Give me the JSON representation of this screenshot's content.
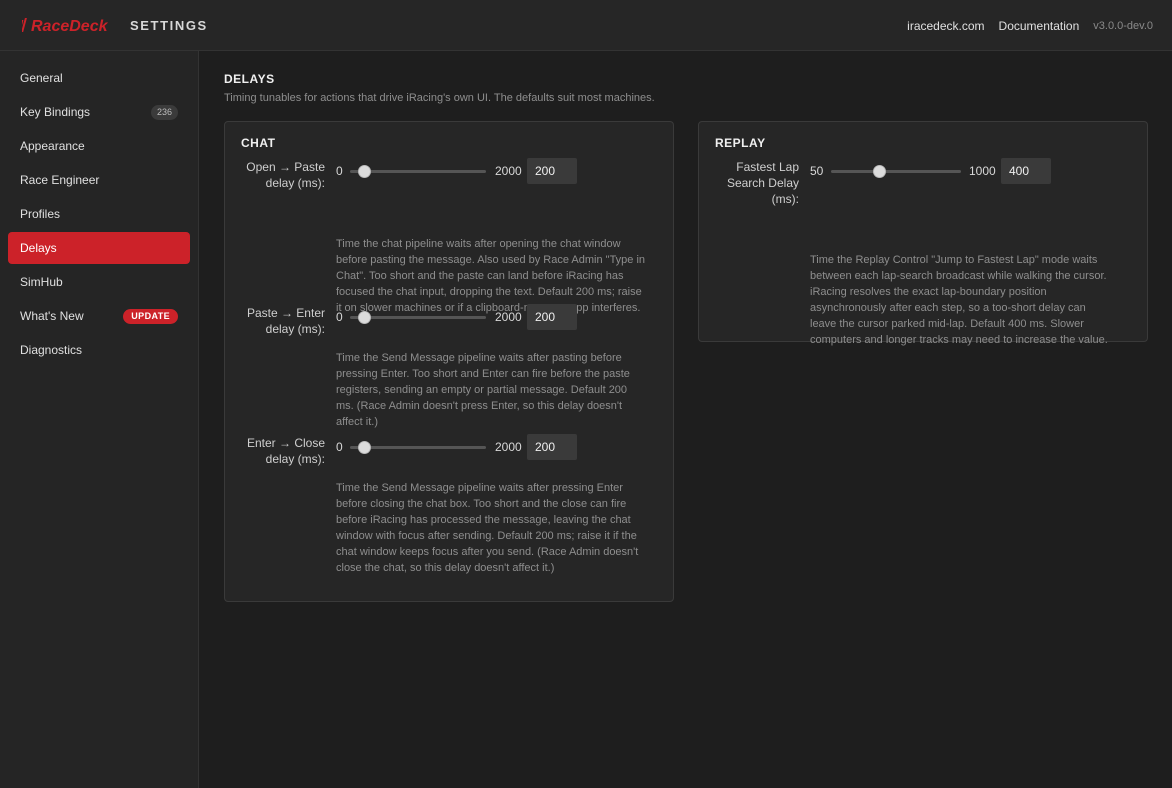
{
  "app": {
    "logo_text": "RaceDeck",
    "title": "SETTINGS",
    "links": [
      "iracedeck.com",
      "Documentation"
    ],
    "version": "v3.0.0-dev.0",
    "accent": "#cc2229"
  },
  "sidebar": {
    "items": [
      {
        "label": "General"
      },
      {
        "label": "Key Bindings",
        "count": "236"
      },
      {
        "label": "Appearance"
      },
      {
        "label": "Race Engineer"
      },
      {
        "label": "Profiles"
      },
      {
        "label": "Delays",
        "active": true
      },
      {
        "label": "SimHub"
      },
      {
        "label": "What's New",
        "badge": "UPDATE"
      },
      {
        "label": "Diagnostics"
      }
    ]
  },
  "main": {
    "title": "DELAYS",
    "description": "Timing tunables for actions that drive iRacing's own UI. The defaults suit most machines.",
    "chat": {
      "title": "CHAT",
      "settings": [
        {
          "label_line1": "Open → Paste",
          "label_line2": "delay (ms):",
          "min": "0",
          "max": "2000",
          "value": "200",
          "fraction": 0.1,
          "help": "Time the chat pipeline waits after opening the chat window before pasting the message. Also used by Race Admin \"Type in Chat\". Too short and the paste can land before iRacing has focused the chat input, dropping the text. Default 200 ms; raise it on slower machines or if a clipboard-manager app interferes."
        },
        {
          "label_line1": "Paste → Enter",
          "label_line2": "delay (ms):",
          "min": "0",
          "max": "2000",
          "value": "200",
          "fraction": 0.1,
          "help": "Time the Send Message pipeline waits after pasting before pressing Enter. Too short and Enter can fire before the paste registers, sending an empty or partial message. Default 200 ms. (Race Admin doesn't press Enter, so this delay doesn't affect it.)"
        },
        {
          "label_line1": "Enter → Close",
          "label_line2": "delay (ms):",
          "min": "0",
          "max": "2000",
          "value": "200",
          "fraction": 0.1,
          "help": "Time the Send Message pipeline waits after pressing Enter before closing the chat box. Too short and the close can fire before iRacing has processed the message, leaving the chat window with focus after sending. Default 200 ms; raise it if the chat window keeps focus after you send. (Race Admin doesn't close the chat, so this delay doesn't affect it.)"
        }
      ]
    },
    "replay": {
      "title": "REPLAY",
      "setting": {
        "label_line1": "Fastest Lap",
        "label_line2": "Search Delay",
        "label_line3": "(ms):",
        "min": "50",
        "max": "1000",
        "value": "400",
        "fraction": 0.37,
        "help": "Time the Replay Control \"Jump to Fastest Lap\" mode waits between each lap-search broadcast while walking the cursor. iRacing resolves the exact lap-boundary position asynchronously after each step, so a too-short delay can leave the cursor parked mid-lap. Default 400 ms. Slower computers and longer tracks may need to increase the value."
      }
    }
  }
}
